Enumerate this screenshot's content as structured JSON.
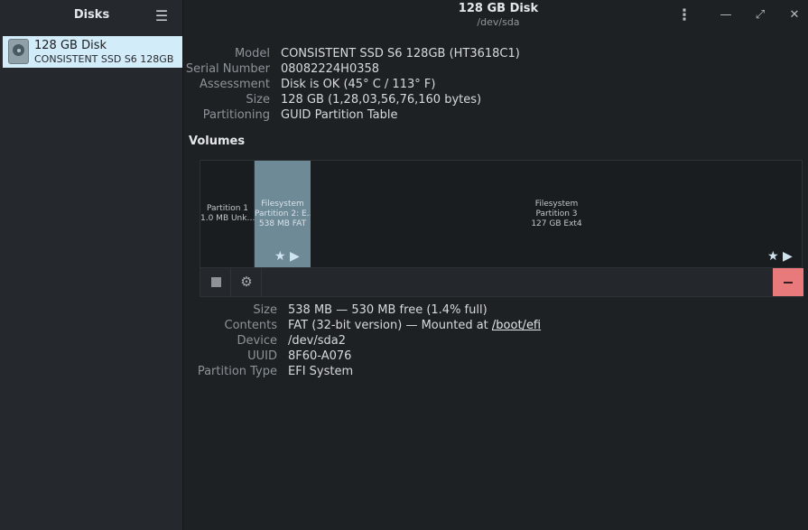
{
  "sidebar": {
    "title": "Disks",
    "menu_icon": "hamburger-menu-icon",
    "disks": [
      {
        "name": "128 GB Disk",
        "model": "CONSISTENT SSD S6 128GB"
      }
    ]
  },
  "header": {
    "title": "128 GB Disk",
    "subtitle": "/dev/sda",
    "buttons": {
      "menu": "⋮",
      "minimize": "—",
      "maximize": "⤢",
      "close": "✕"
    }
  },
  "disk_info": {
    "model_label": "Model",
    "model": "CONSISTENT SSD S6 128GB (HT3618C1)",
    "serial_label": "Serial Number",
    "serial": "08082224H0358",
    "assessment_label": "Assessment",
    "assessment": "Disk is OK (45° C / 113° F)",
    "size_label": "Size",
    "size": "128 GB (1,28,03,56,76,160 bytes)",
    "partitioning_label": "Partitioning",
    "partitioning": "GUID Partition Table"
  },
  "volumes": {
    "title": "Volumes",
    "partitions": [
      {
        "line1": "Partition 1",
        "line2": "1.0 MB Unk…"
      },
      {
        "line1": "Filesystem",
        "line2": "Partition 2: E…",
        "line3": "538 MB FAT"
      },
      {
        "line1": "Filesystem",
        "line2": "Partition 3",
        "line3": "127 GB Ext4"
      }
    ],
    "pins": "★ ▶"
  },
  "selected_volume": {
    "size_label": "Size",
    "size": "538 MB — 530 MB free (1.4% full)",
    "contents_label": "Contents",
    "contents_prefix": "FAT (32-bit version) — Mounted at ",
    "mount_point": "/boot/efi",
    "device_label": "Device",
    "device": "/dev/sda2",
    "uuid_label": "UUID",
    "uuid": "8F60-A076",
    "ptype_label": "Partition Type",
    "ptype": "EFI System"
  }
}
